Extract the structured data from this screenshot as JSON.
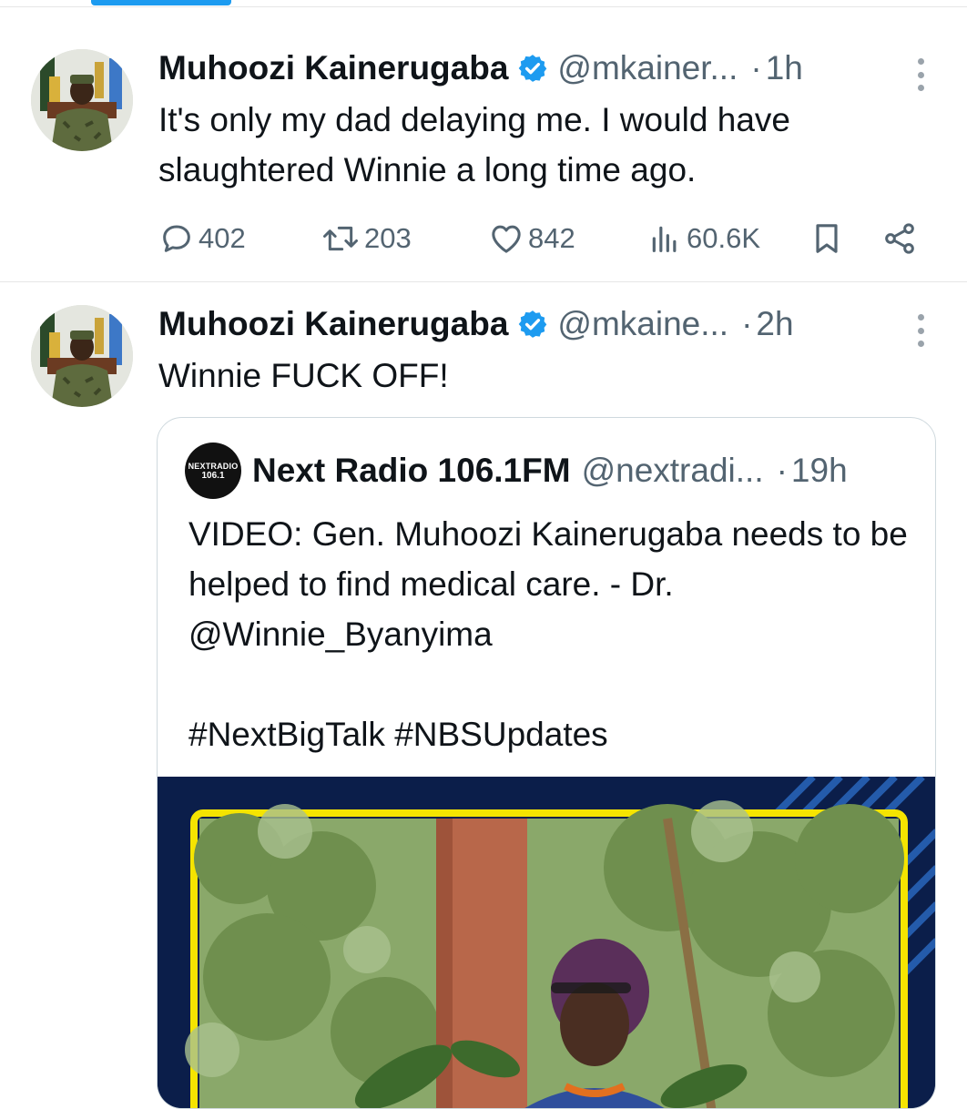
{
  "colors": {
    "accent": "#1d9bf0",
    "text_primary": "#0f1419",
    "text_secondary": "#536471",
    "divider": "#e6e6e6",
    "media_background": "#0b1e4a",
    "media_frame": "#f5e400"
  },
  "tweets": [
    {
      "author_name": "Muhoozi Kainerugaba",
      "handle": "@mkainer...",
      "separator": "·",
      "time": "1h",
      "text": "It's only my dad delaying me. I would have slaughtered Winnie a long time ago.",
      "stats": {
        "replies": "402",
        "retweets": "203",
        "likes": "842",
        "views": "60.6K"
      },
      "icons": [
        "verified-badge-icon",
        "more-options-icon",
        "reply-icon",
        "retweet-icon",
        "like-icon",
        "views-icon",
        "bookmark-icon",
        "share-icon"
      ]
    },
    {
      "author_name": "Muhoozi Kainerugaba",
      "handle": "@mkaine...",
      "separator": "·",
      "time": "2h",
      "text": "Winnie FUCK OFF!",
      "quoted": {
        "author_name": "Next Radio 106.1FM",
        "handle": "@nextradi...",
        "separator": "·",
        "time": "19h",
        "logo_line1": "NEXTRADIO",
        "logo_line2": "106.1",
        "text_lines": [
          "VIDEO: Gen. Muhoozi Kainerugaba needs to be helped to find medical care. - Dr. @Winnie_Byanyima",
          "",
          "#NextBigTalk #NBSUpdates"
        ]
      }
    }
  ]
}
